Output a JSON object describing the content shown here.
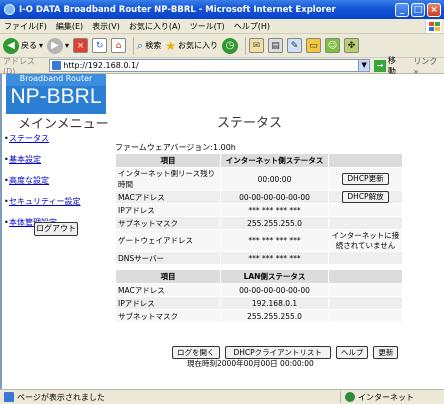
{
  "window": {
    "title": "I-O DATA Broadband Router NP-BBRL - Microsoft Internet Explorer"
  },
  "menubar": [
    "ファイル(F)",
    "編集(E)",
    "表示(V)",
    "お気に入り(A)",
    "ツール(T)",
    "ヘルプ(H)"
  ],
  "toolbar": {
    "back": "戻る",
    "search": "検索",
    "favorites": "お気に入り"
  },
  "address": {
    "label": "アドレス(D)",
    "url": "http://192.168.0.1/",
    "go": "移動",
    "links": "リンク »"
  },
  "banner": {
    "small": "Broadband Router",
    "big": "NP-BBRL"
  },
  "sidebar": {
    "title": "メインメニュー",
    "items": [
      "ステータス",
      "基本設定",
      "高度な設定",
      "セキュリティー設定",
      "本体管理設定"
    ],
    "logout": "ログアウト"
  },
  "main": {
    "title": "ステータス",
    "firmware": "ファームウェアバージョン:1.00h",
    "internet": {
      "headers": [
        "項目",
        "インターネット側ステータス"
      ],
      "rows": [
        [
          "インターネット側リース残り時間",
          "00:00:00"
        ],
        [
          "MACアドレス",
          "00-00-00-00-00-00"
        ],
        [
          "IPアドレス",
          "*** *** *** ***"
        ],
        [
          "サブネットマスク",
          "255.255.255.0"
        ],
        [
          "ゲートウェイアドレス",
          "*** *** *** ***"
        ],
        [
          "DNSサーバー",
          "*** *** *** ***"
        ]
      ],
      "dhcp_renew": "DHCP更新",
      "dhcp_release": "DHCP解放",
      "not_connected": "インターネットに接続されていません"
    },
    "lan": {
      "headers": [
        "項目",
        "LAN側ステータス"
      ],
      "rows": [
        [
          "MACアドレス",
          "00-00-00-00-00-00"
        ],
        [
          "IPアドレス",
          "192.168.0.1"
        ],
        [
          "サブネットマスク",
          "255.255.255.0"
        ]
      ]
    },
    "buttons": {
      "log": "ログを開く",
      "dhcp_list": "DHCPクライアントリスト",
      "help": "ヘルプ",
      "refresh": "更新"
    },
    "current_time": "現在時刻2000年00月00日 00:00:00"
  },
  "status": {
    "left": "ページが表示されました",
    "zone": "インターネット"
  }
}
